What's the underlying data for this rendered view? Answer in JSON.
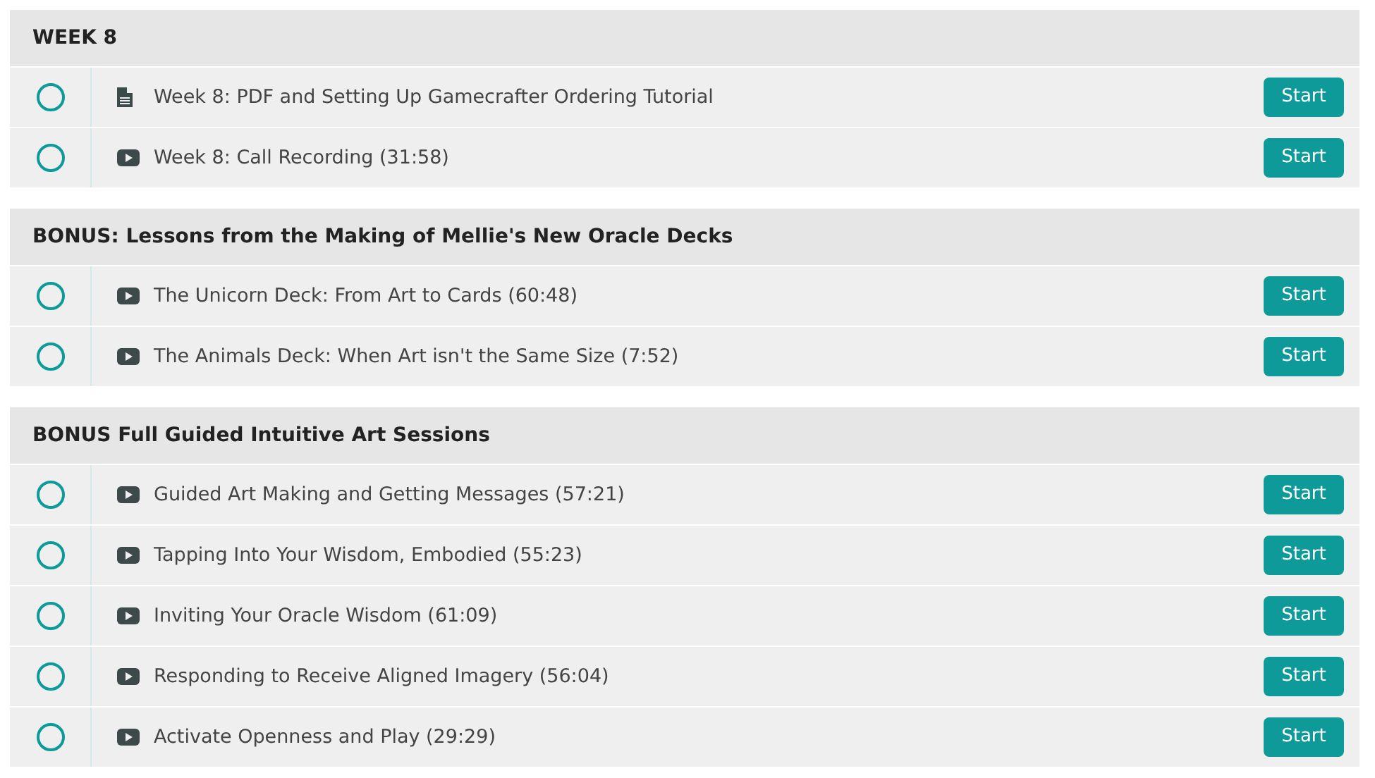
{
  "sections": [
    {
      "title": "WEEK 8",
      "lessons": [
        {
          "kind": "pdf",
          "title": "Week 8: PDF and Setting Up Gamecrafter Ordering Tutorial",
          "completed": false,
          "button": "Start"
        },
        {
          "kind": "video",
          "title": "Week 8: Call Recording (31:58)",
          "completed": false,
          "button": "Start"
        }
      ]
    },
    {
      "title": "BONUS: Lessons from the Making of Mellie's New Oracle Decks",
      "lessons": [
        {
          "kind": "video",
          "title": "The Unicorn Deck: From Art to Cards (60:48)",
          "completed": false,
          "button": "Start"
        },
        {
          "kind": "video",
          "title": "The Animals Deck: When Art isn't the Same Size (7:52)",
          "completed": false,
          "button": "Start"
        }
      ]
    },
    {
      "title": "BONUS Full Guided Intuitive Art Sessions",
      "lessons": [
        {
          "kind": "video",
          "title": "Guided Art Making and Getting Messages (57:21)",
          "completed": false,
          "button": "Start"
        },
        {
          "kind": "video",
          "title": "Tapping Into Your Wisdom, Embodied (55:23)",
          "completed": false,
          "button": "Start"
        },
        {
          "kind": "video",
          "title": "Inviting Your Oracle Wisdom (61:09)",
          "completed": false,
          "button": "Start"
        },
        {
          "kind": "video",
          "title": "Responding to Receive Aligned Imagery (56:04)",
          "completed": false,
          "button": "Start"
        },
        {
          "kind": "video",
          "title": "Activate Openness and Play (29:29)",
          "completed": false,
          "button": "Start"
        }
      ]
    }
  ]
}
